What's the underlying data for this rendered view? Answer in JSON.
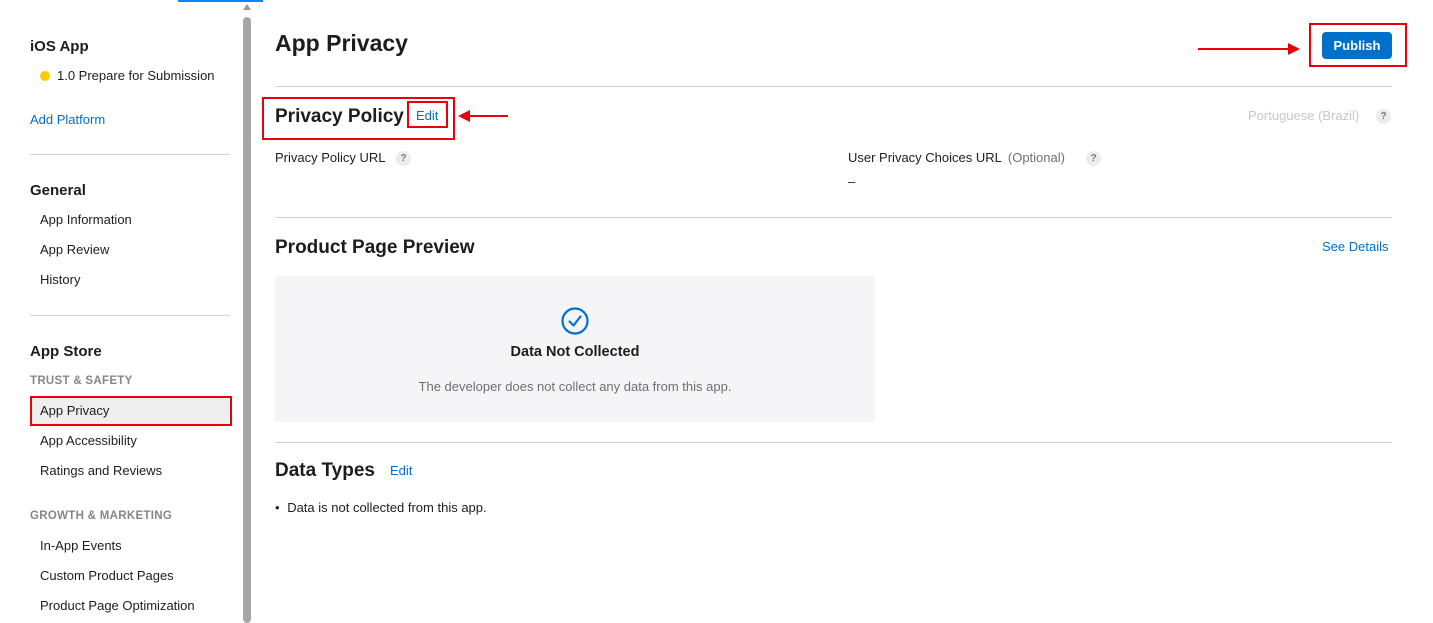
{
  "sidebar": {
    "app_title": "iOS App",
    "version_status": "1.0 Prepare for Submission",
    "add_platform": "Add Platform",
    "general": {
      "heading": "General",
      "items": [
        "App Information",
        "App Review",
        "History"
      ]
    },
    "app_store": {
      "heading": "App Store",
      "trust_safety": "TRUST & SAFETY",
      "trust_items": [
        "App Privacy",
        "App Accessibility",
        "Ratings and Reviews"
      ],
      "growth_marketing": "GROWTH & MARKETING",
      "growth_items": [
        "In-App Events",
        "Custom Product Pages",
        "Product Page Optimization"
      ]
    },
    "selected_item": "App Privacy"
  },
  "main": {
    "page_title": "App Privacy",
    "publish_label": "Publish",
    "privacy_policy": {
      "title": "Privacy Policy",
      "edit_label": "Edit",
      "language": "Portuguese (Brazil)",
      "policy_url_label": "Privacy Policy URL",
      "choices_url_label": "User Privacy Choices URL",
      "choices_optional": "(Optional)",
      "choices_url_value": "–"
    },
    "product_page_preview": {
      "title": "Product Page Preview",
      "see_details": "See Details",
      "card_title": "Data Not Collected",
      "card_description": "The developer does not collect any data from this app."
    },
    "data_types": {
      "title": "Data Types",
      "edit_label": "Edit",
      "items": [
        "Data is not collected from this app."
      ]
    }
  },
  "help_icon_glyph": "?",
  "colors": {
    "accent": "#0070c9",
    "annotation_red": "#e8000b",
    "status_yellow": "#ffcc00"
  }
}
